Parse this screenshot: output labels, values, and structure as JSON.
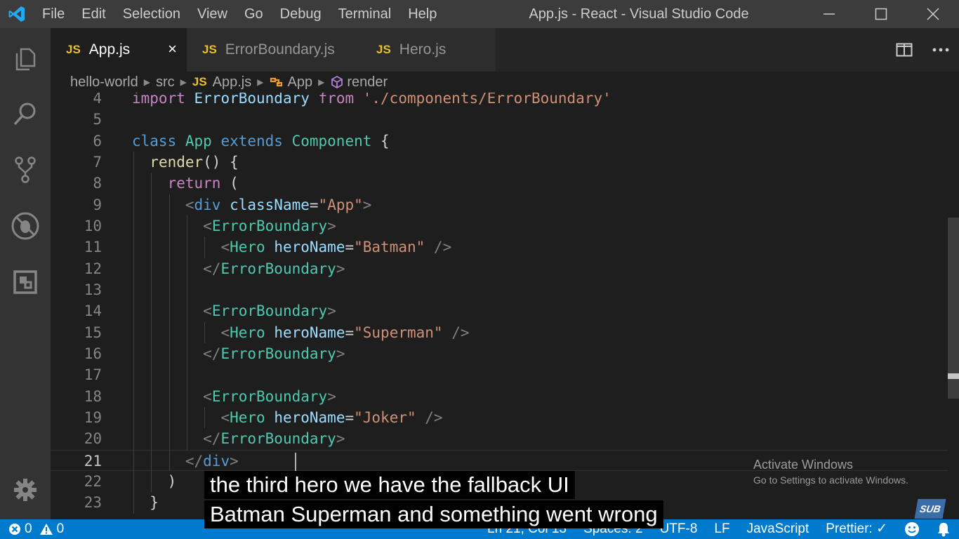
{
  "window": {
    "title": "App.js - React - Visual Studio Code",
    "menu": [
      "File",
      "Edit",
      "Selection",
      "View",
      "Go",
      "Debug",
      "Terminal",
      "Help"
    ]
  },
  "activity_bar": {
    "icons": [
      "files-icon",
      "search-icon",
      "source-control-icon",
      "debug-icon",
      "extensions-icon",
      "gear-icon"
    ]
  },
  "tabs": [
    {
      "badge": "JS",
      "label": "App.js",
      "active": true,
      "close": "×"
    },
    {
      "badge": "JS",
      "label": "ErrorBoundary.js",
      "active": false
    },
    {
      "badge": "JS",
      "label": "Hero.js",
      "active": false
    }
  ],
  "breadcrumb": {
    "items": [
      "hello-world",
      "src",
      "App.js",
      "App",
      "render"
    ],
    "file_badge": "JS"
  },
  "editor": {
    "line_numbers": [
      "4",
      "5",
      "6",
      "7",
      "8",
      "9",
      "10",
      "11",
      "12",
      "13",
      "14",
      "15",
      "16",
      "17",
      "18",
      "19",
      "20",
      "21",
      "22",
      "23"
    ],
    "current_line": "21",
    "lines": [
      [
        {
          "t": "import ",
          "c": "ctl"
        },
        {
          "t": "ErrorBoundary ",
          "c": "attr"
        },
        {
          "t": "from ",
          "c": "ctl"
        },
        {
          "t": "'./components/ErrorBoundary'",
          "c": "str"
        }
      ],
      [],
      [
        {
          "t": "class ",
          "c": "kw"
        },
        {
          "t": "App ",
          "c": "cls"
        },
        {
          "t": "extends ",
          "c": "kw"
        },
        {
          "t": "Component ",
          "c": "cls"
        },
        {
          "t": "{",
          "c": "plain"
        }
      ],
      [
        {
          "t": "  "
        },
        {
          "t": "render",
          "c": "fn"
        },
        {
          "t": "() {",
          "c": "plain"
        }
      ],
      [
        {
          "t": "    "
        },
        {
          "t": "return ",
          "c": "ctl"
        },
        {
          "t": "(",
          "c": "plain"
        }
      ],
      [
        {
          "t": "      "
        },
        {
          "t": "<",
          "c": "punc"
        },
        {
          "t": "div ",
          "c": "kw"
        },
        {
          "t": "className",
          "c": "attr"
        },
        {
          "t": "=",
          "c": "plain"
        },
        {
          "t": "\"App\"",
          "c": "str"
        },
        {
          "t": ">",
          "c": "punc"
        }
      ],
      [
        {
          "t": "        "
        },
        {
          "t": "<",
          "c": "punc"
        },
        {
          "t": "ErrorBoundary",
          "c": "tag"
        },
        {
          "t": ">",
          "c": "punc"
        }
      ],
      [
        {
          "t": "          "
        },
        {
          "t": "<",
          "c": "punc"
        },
        {
          "t": "Hero ",
          "c": "tag"
        },
        {
          "t": "heroName",
          "c": "attr"
        },
        {
          "t": "=",
          "c": "plain"
        },
        {
          "t": "\"Batman\"",
          "c": "str"
        },
        {
          "t": " />",
          "c": "punc"
        }
      ],
      [
        {
          "t": "        "
        },
        {
          "t": "</",
          "c": "punc"
        },
        {
          "t": "ErrorBoundary",
          "c": "tag"
        },
        {
          "t": ">",
          "c": "punc"
        }
      ],
      [],
      [
        {
          "t": "        "
        },
        {
          "t": "<",
          "c": "punc"
        },
        {
          "t": "ErrorBoundary",
          "c": "tag"
        },
        {
          "t": ">",
          "c": "punc"
        }
      ],
      [
        {
          "t": "          "
        },
        {
          "t": "<",
          "c": "punc"
        },
        {
          "t": "Hero ",
          "c": "tag"
        },
        {
          "t": "heroName",
          "c": "attr"
        },
        {
          "t": "=",
          "c": "plain"
        },
        {
          "t": "\"Superman\"",
          "c": "str"
        },
        {
          "t": " />",
          "c": "punc"
        }
      ],
      [
        {
          "t": "        "
        },
        {
          "t": "</",
          "c": "punc"
        },
        {
          "t": "ErrorBoundary",
          "c": "tag"
        },
        {
          "t": ">",
          "c": "punc"
        }
      ],
      [],
      [
        {
          "t": "        "
        },
        {
          "t": "<",
          "c": "punc"
        },
        {
          "t": "ErrorBoundary",
          "c": "tag"
        },
        {
          "t": ">",
          "c": "punc"
        }
      ],
      [
        {
          "t": "          "
        },
        {
          "t": "<",
          "c": "punc"
        },
        {
          "t": "Hero ",
          "c": "tag"
        },
        {
          "t": "heroName",
          "c": "attr"
        },
        {
          "t": "=",
          "c": "plain"
        },
        {
          "t": "\"Joker\"",
          "c": "str"
        },
        {
          "t": " />",
          "c": "punc"
        }
      ],
      [
        {
          "t": "        "
        },
        {
          "t": "</",
          "c": "punc"
        },
        {
          "t": "ErrorBoundary",
          "c": "tag"
        },
        {
          "t": ">",
          "c": "punc"
        }
      ],
      [
        {
          "t": "      "
        },
        {
          "t": "</",
          "c": "punc"
        },
        {
          "t": "div",
          "c": "kw"
        },
        {
          "t": ">",
          "c": "punc"
        }
      ],
      [
        {
          "t": "    "
        },
        {
          "t": ")",
          "c": "plain"
        }
      ],
      [
        {
          "t": "  "
        },
        {
          "t": "}",
          "c": "plain"
        }
      ]
    ]
  },
  "status_bar": {
    "errors": "0",
    "warnings": "0",
    "position": "Ln 21, Col 13",
    "spaces": "Spaces: 2",
    "encoding": "UTF-8",
    "eol": "LF",
    "language": "JavaScript",
    "formatter": "Prettier: ✓"
  },
  "overlay": {
    "activate_title": "Activate Windows",
    "activate_sub": "Go to Settings to activate Windows.",
    "subtitle_line1": "the third hero we have the fallback UI",
    "subtitle_line2": "Batman Superman and something went wrong",
    "badge": "SUB"
  },
  "colors": {
    "statusbar": "#007acc",
    "titlebar": "#3c3c3c",
    "activitybar": "#333333",
    "editor_bg": "#1e1e1e",
    "js_badge": "#e8c032"
  }
}
